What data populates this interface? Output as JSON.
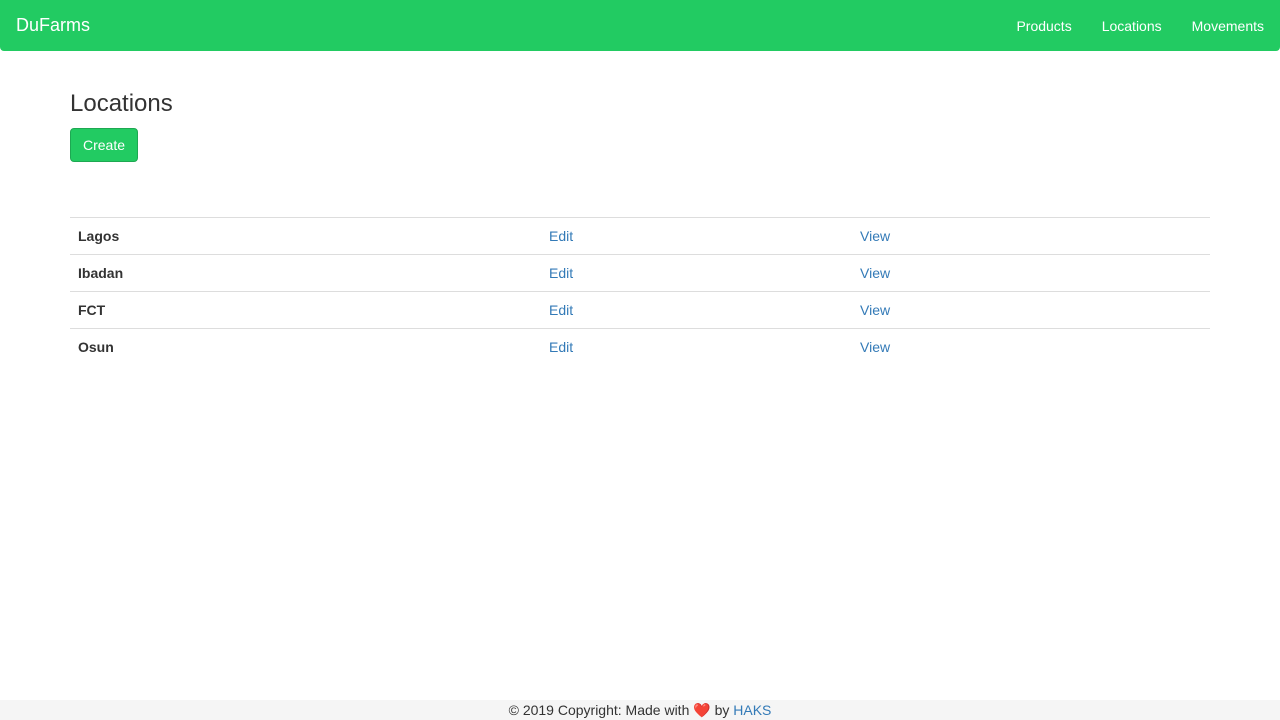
{
  "navbar": {
    "brand": "DuFarms",
    "links": [
      {
        "label": "Products"
      },
      {
        "label": "Locations"
      },
      {
        "label": "Movements"
      }
    ]
  },
  "main": {
    "title": "Locations",
    "create_label": "Create",
    "rows": [
      {
        "name": "Lagos",
        "edit": "Edit",
        "view": "View"
      },
      {
        "name": "Ibadan",
        "edit": "Edit",
        "view": "View"
      },
      {
        "name": "FCT",
        "edit": "Edit",
        "view": "View"
      },
      {
        "name": "Osun",
        "edit": "Edit",
        "view": "View"
      }
    ]
  },
  "footer": {
    "prefix": "© 2019 Copyright: Made with",
    "heart": "❤️",
    "by": "by",
    "author": "HAKS"
  },
  "colors": {
    "brand_green": "#22cb62",
    "link_blue": "#337ab7"
  }
}
